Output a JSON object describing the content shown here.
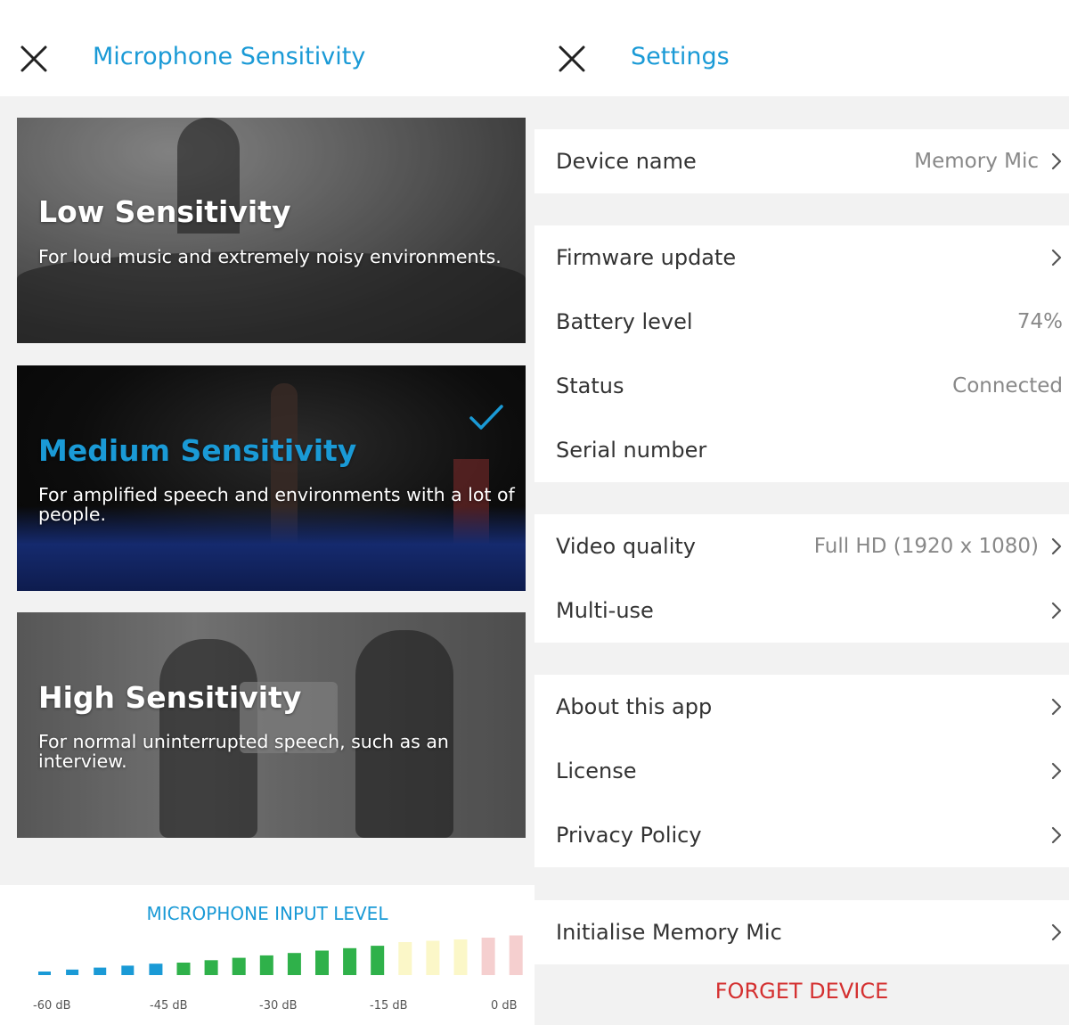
{
  "sensitivity_screen": {
    "title": "Microphone Sensitivity",
    "options": [
      {
        "title": "Low Sensitivity",
        "description": "For loud music and extremely noisy environments.",
        "selected": false
      },
      {
        "title": "Medium Sensitivity",
        "description": "For amplified speech and environments with a lot of people.",
        "selected": true
      },
      {
        "title": "High Sensitivity",
        "description": "For normal uninterrupted speech, such as an interview.",
        "selected": false
      }
    ],
    "input_level": {
      "title": "MICROPHONE INPUT LEVEL",
      "scale_labels": [
        "-60 dB",
        "-45 dB",
        "-30 dB",
        "-15 dB",
        "0 dB"
      ],
      "segments_total": 18,
      "segments_active": 13,
      "colors": {
        "blue": "#1a9ad6",
        "green": "#2fb14a",
        "yellow_inactive": "#fbf7c8",
        "red_inactive": "#f5cfcf"
      }
    }
  },
  "settings_screen": {
    "title": "Settings",
    "groups": [
      {
        "rows": [
          {
            "label": "Device name",
            "value": "Memory Mic",
            "chevron": true
          }
        ]
      },
      {
        "rows": [
          {
            "label": "Firmware update",
            "value": "",
            "chevron": true
          },
          {
            "label": "Battery level",
            "value": "74%",
            "chevron": false
          },
          {
            "label": "Status",
            "value": "Connected",
            "chevron": false
          },
          {
            "label": "Serial number",
            "value": "",
            "chevron": false
          }
        ]
      },
      {
        "rows": [
          {
            "label": "Video quality",
            "value": "Full HD (1920 x 1080)",
            "chevron": true
          },
          {
            "label": "Multi-use",
            "value": "",
            "chevron": true
          }
        ]
      },
      {
        "rows": [
          {
            "label": "About this app",
            "value": "",
            "chevron": true
          },
          {
            "label": "License",
            "value": "",
            "chevron": true
          },
          {
            "label": "Privacy Policy",
            "value": "",
            "chevron": true
          }
        ]
      },
      {
        "rows": [
          {
            "label": "Initialise Memory Mic",
            "value": "",
            "chevron": true
          }
        ]
      }
    ],
    "forget_label": "FORGET DEVICE",
    "accent_color": "#1a9ad6",
    "danger_color": "#d43030"
  }
}
